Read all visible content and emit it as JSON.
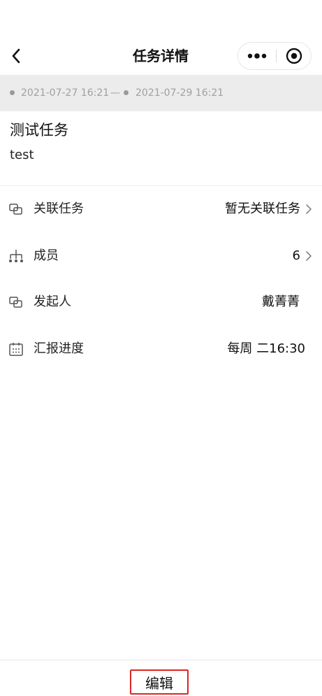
{
  "header": {
    "title": "任务详情",
    "back_icon": "chevron-left-icon",
    "more_icon": "more-dots-icon",
    "close_icon": "target-circle-icon"
  },
  "date_range": {
    "start": "2021-07-27 16:21",
    "separator": "—",
    "end": "2021-07-29 16:21"
  },
  "task": {
    "title": "测试任务",
    "description": "test"
  },
  "rows": [
    {
      "icon": "linked-squares-icon",
      "label": "关联任务",
      "value": "暂无关联任务",
      "has_chevron": true
    },
    {
      "icon": "org-tree-icon",
      "label": "成员",
      "value": "6",
      "has_chevron": true
    },
    {
      "icon": "linked-squares-icon",
      "label": "发起人",
      "value": "戴菁菁",
      "has_chevron": false
    },
    {
      "icon": "calendar-icon",
      "label": "汇报进度",
      "value": "每周 二16:30",
      "has_chevron": false
    }
  ],
  "footer": {
    "edit_label": "编辑"
  },
  "colors": {
    "date_bar_bg": "#ececec",
    "date_text": "#a0a0a0",
    "edit_border": "#e02424"
  }
}
